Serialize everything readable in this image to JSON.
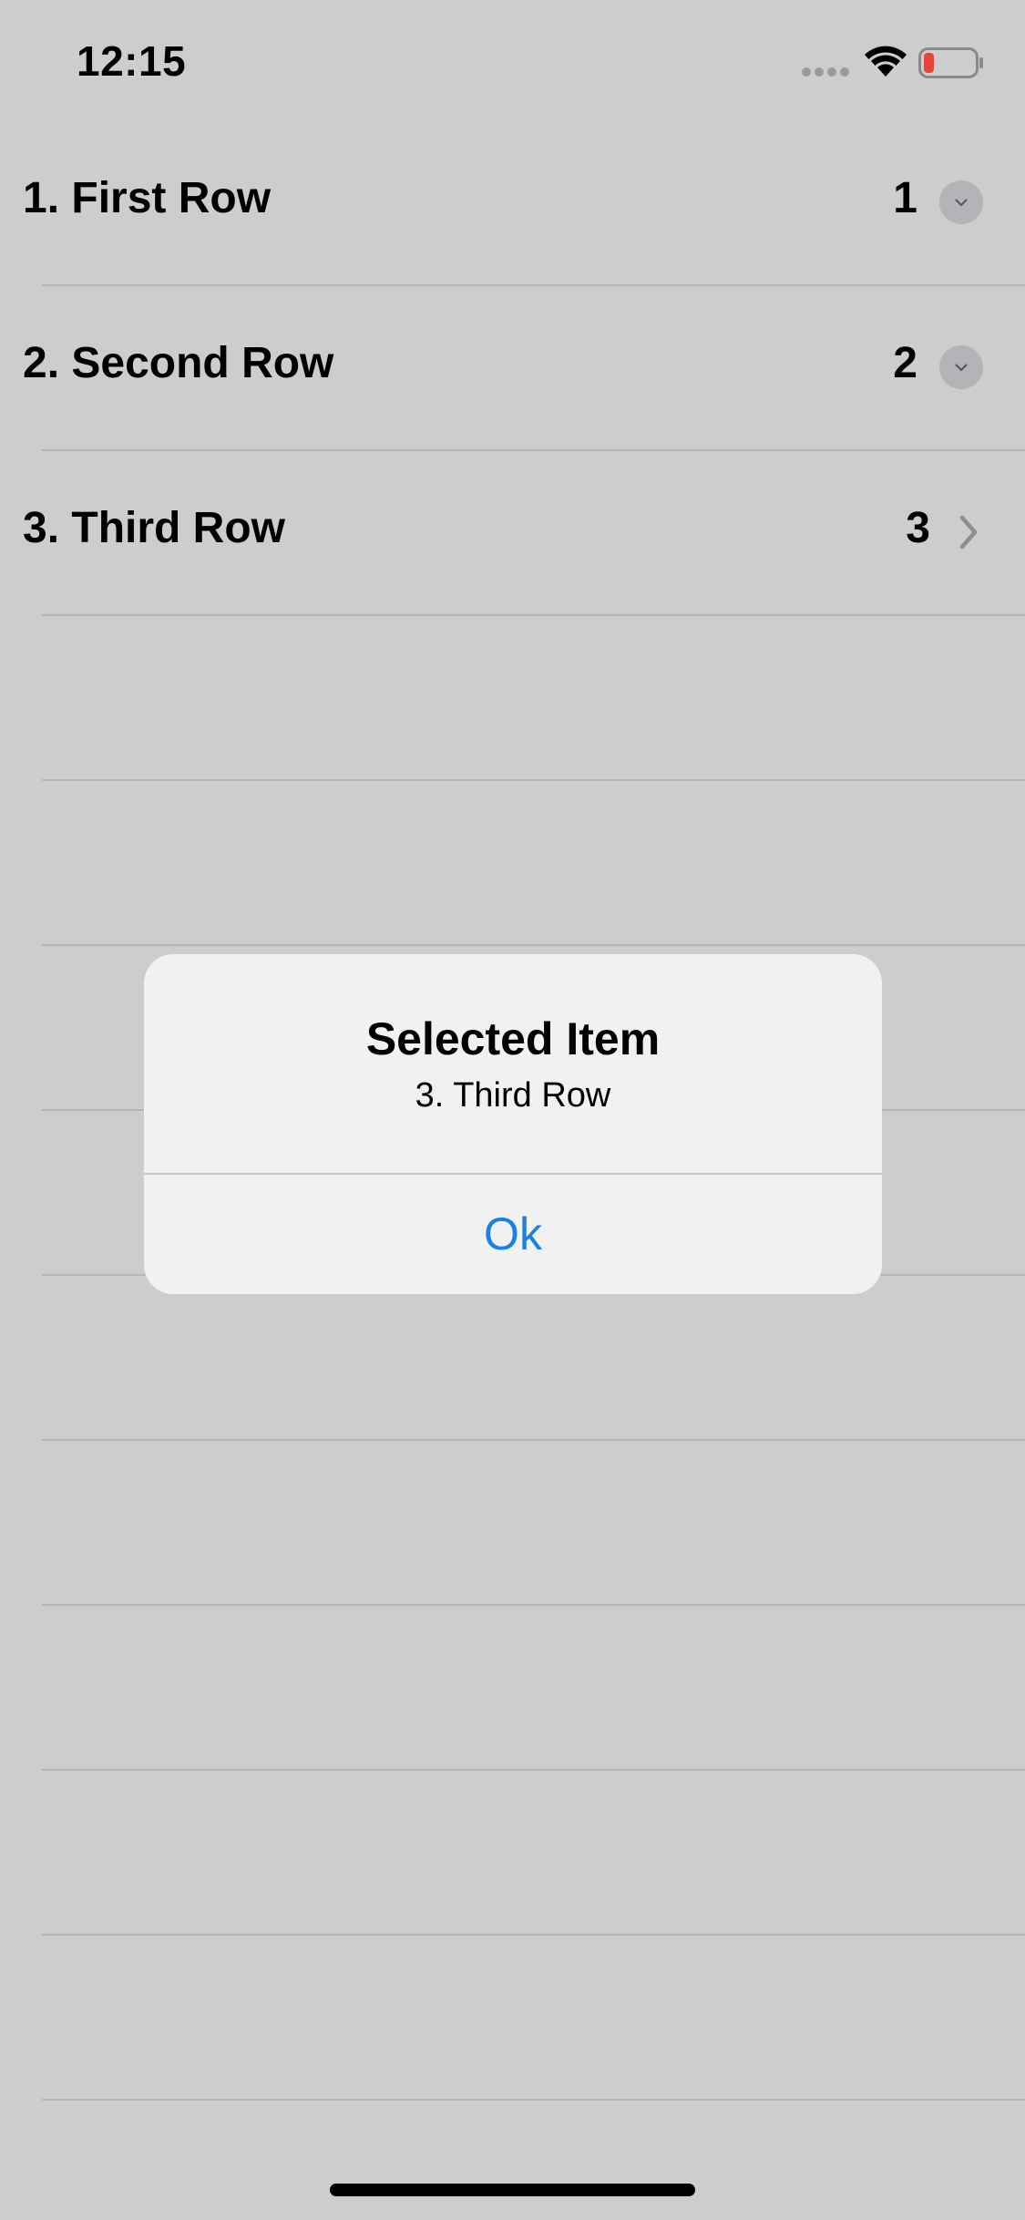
{
  "status_bar": {
    "time": "12:15",
    "battery_color": "#e5443a"
  },
  "list": {
    "rows": [
      {
        "title": "1. First Row",
        "value": "1",
        "accessory": "detail-disclosure"
      },
      {
        "title": "2. Second Row",
        "value": "2",
        "accessory": "detail-disclosure"
      },
      {
        "title": "3. Third Row",
        "value": "3",
        "accessory": "chevron-right"
      }
    ]
  },
  "alert": {
    "title": "Selected Item",
    "message": "3. Third Row",
    "ok_label": "Ok"
  },
  "colors": {
    "background": "#cdcdcd",
    "alert_background": "#f1f1f1",
    "accent": "#1a80e4"
  }
}
